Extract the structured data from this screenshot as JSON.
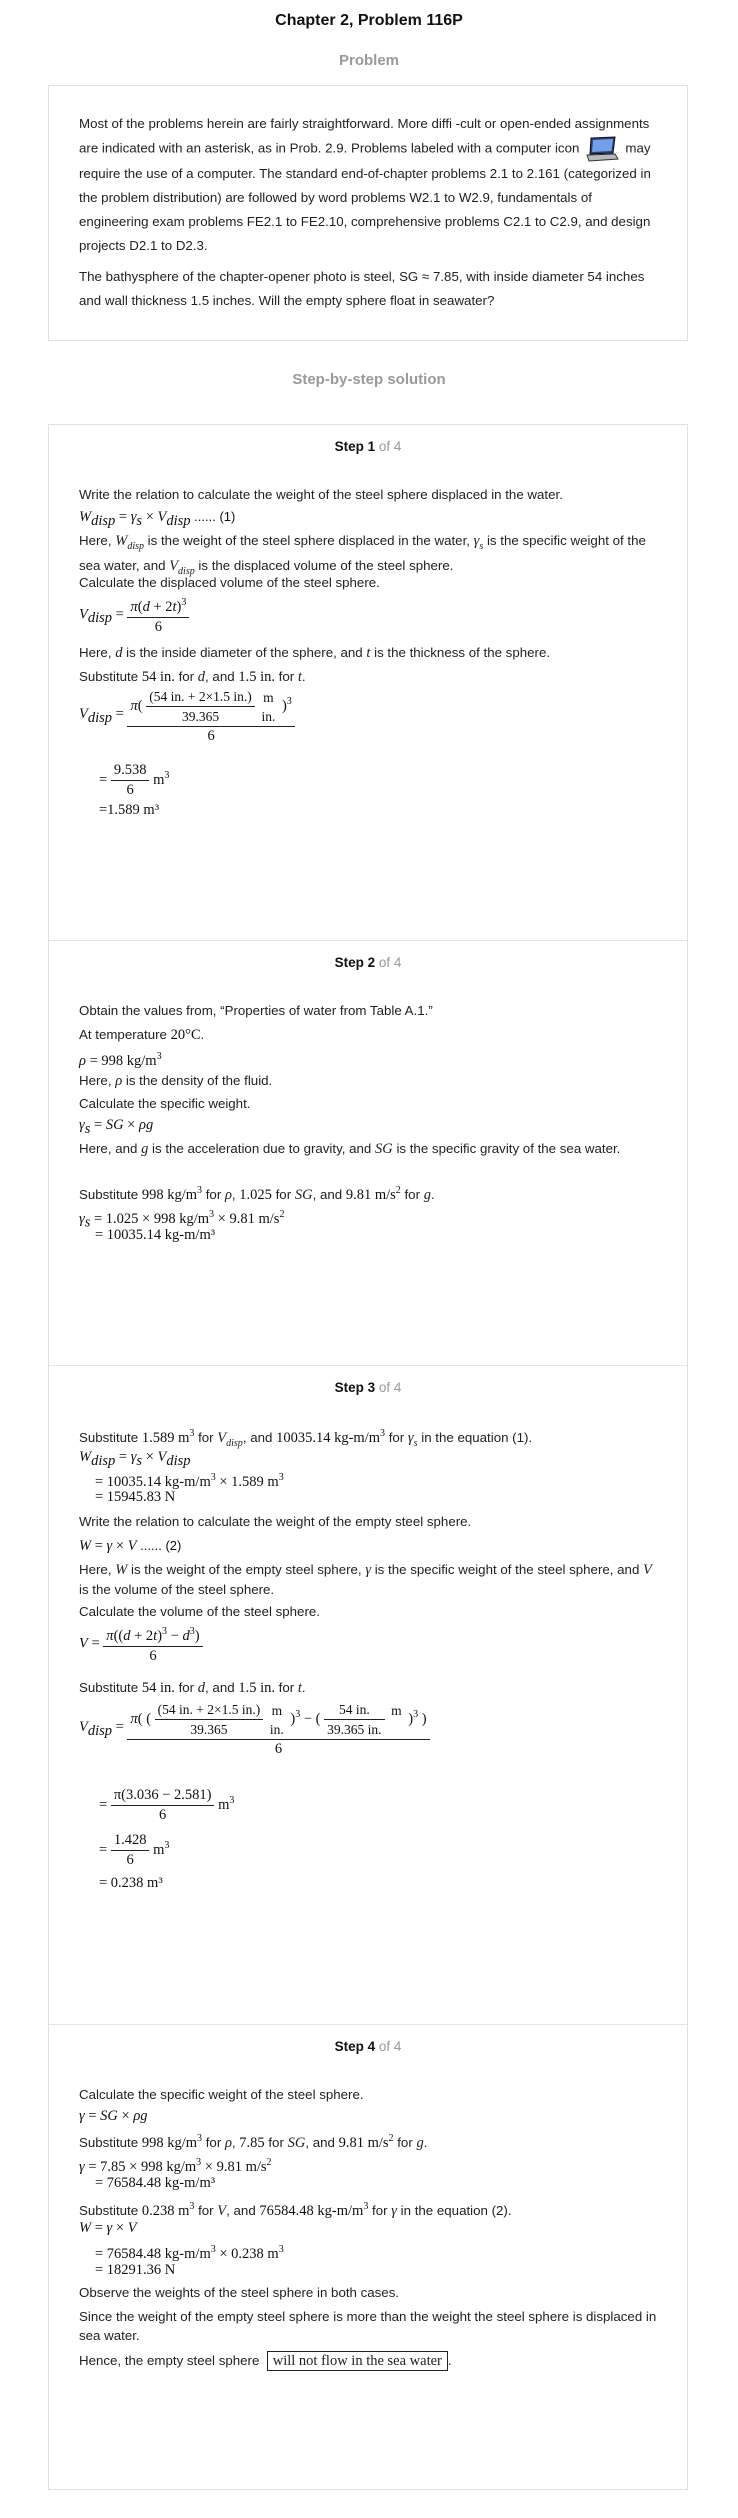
{
  "title": "Chapter 2, Problem 116P",
  "problem_heading": "Problem",
  "problem": {
    "p1_before_icon": "Most of the problems herein are fairly straightforward. More diffi -cult or open-ended assignments are indicated with an asterisk, as in Prob. 2.9. Problems labeled with a computer icon",
    "p1_after_icon": "may require the use of a computer. The standard end-of-chapter problems 2.1 to 2.161 (categorized in the problem distribution) are followed by word problems W2.1 to W2.9, fundamentals of engineering exam problems FE2.1 to FE2.10, comprehensive problems C2.1 to C2.9, and design projects D2.1 to D2.3.",
    "p2": "The bathysphere of the chapter-opener photo is steel, SG ≈ 7.85, with inside diameter 54 inches and wall thickness 1.5 inches. Will the empty sphere float in seawater?",
    "icon": "laptop-computer-icon"
  },
  "solution_heading": "Step-by-step solution",
  "steps": [
    {
      "label": "Step 1",
      "of": "of 4",
      "t1": "Write the relation to calculate the weight of the steel sphere displaced in the water.",
      "eq1": "W_disp = γ_s × V_disp  ...... (1)",
      "t2": "Here, W_disp is the weight of the steel sphere displaced in the water, γ_s is the specific weight of the sea water, and V_disp is the displaced volume of the steel sphere.",
      "t3": "Calculate the displaced volume of the steel sphere.",
      "t4": "Here, d is the inside diameter of the sphere, and t is the thickness of the sphere.",
      "t5": "Substitute 54 in. for d, and 1.5 in. for t.",
      "r1": "9.538",
      "r2": "=1.589 m³"
    },
    {
      "label": "Step 2",
      "of": "of 4",
      "t1": "Obtain the values from, “Properties of water from Table A.1.”",
      "t2": "At temperature 20°C.",
      "eq1": "ρ = 998 kg/m³",
      "t3": "Here, ρ is the density of the fluid.",
      "t4": "Calculate the specific weight.",
      "eq2": "γ_s = SG × ρg",
      "t5": "Here, and g is the acceleration due to gravity, and SG is the specific gravity of the sea water.",
      "t6": "Substitute 998 kg/m³ for ρ, 1.025 for SG, and 9.81 m/s² for g.",
      "eq3": "γ_s = 1.025 × 998 kg/m³ × 9.81 m/s²",
      "eq4": "= 10035.14 kg-m/m³"
    },
    {
      "label": "Step 3",
      "of": "of 4",
      "t1": "Substitute 1.589 m³ for V_disp, and 10035.14 kg-m/m³ for γ_s in the equation (1).",
      "eq1": "W_disp = γ_s × V_disp",
      "eq2": "= 10035.14 kg-m/m³ × 1.589 m³",
      "eq3": "= 15945.83 N",
      "t2": "Write the relation to calculate the weight of the empty steel sphere.",
      "eq4": "W = γ × V  ...... (2)",
      "t3": "Here, W is the weight of the empty steel sphere, γ is the specific weight of the steel sphere, and V is the volume of the steel sphere.",
      "t4": "Calculate the volume of the steel sphere.",
      "t5": "Substitute 54 in. for d, and 1.5 in. for t.",
      "r1": "π(3.036 − 2.581)",
      "r2": "1.428",
      "r3": "= 0.238 m³"
    },
    {
      "label": "Step 4",
      "of": "of 4",
      "t1": "Calculate the specific weight of the steel sphere.",
      "eq1": "γ = SG × ρg",
      "t2": "Substitute 998 kg/m³ for ρ, 7.85 for SG, and 9.81 m/s² for g.",
      "eq2": "γ = 7.85 × 998 kg/m³ × 9.81 m/s²",
      "eq3": "= 76584.48 kg-m/m³",
      "t3": "Substitute 0.238 m³ for V, and 76584.48 kg-m/m³ for γ in the equation (2).",
      "eq4": "W = γ × V",
      "eq5": "= 76584.48 kg-m/m³ × 0.238 m³",
      "eq6": "= 18291.36 N",
      "t4": "Observe the weights of the steel sphere in both cases.",
      "t5": "Since the weight of the empty steel sphere is more than the weight the steel sphere is displaced in sea water.",
      "t6": "Hence, the empty steel sphere",
      "answer": "will not flow in the sea water"
    }
  ]
}
